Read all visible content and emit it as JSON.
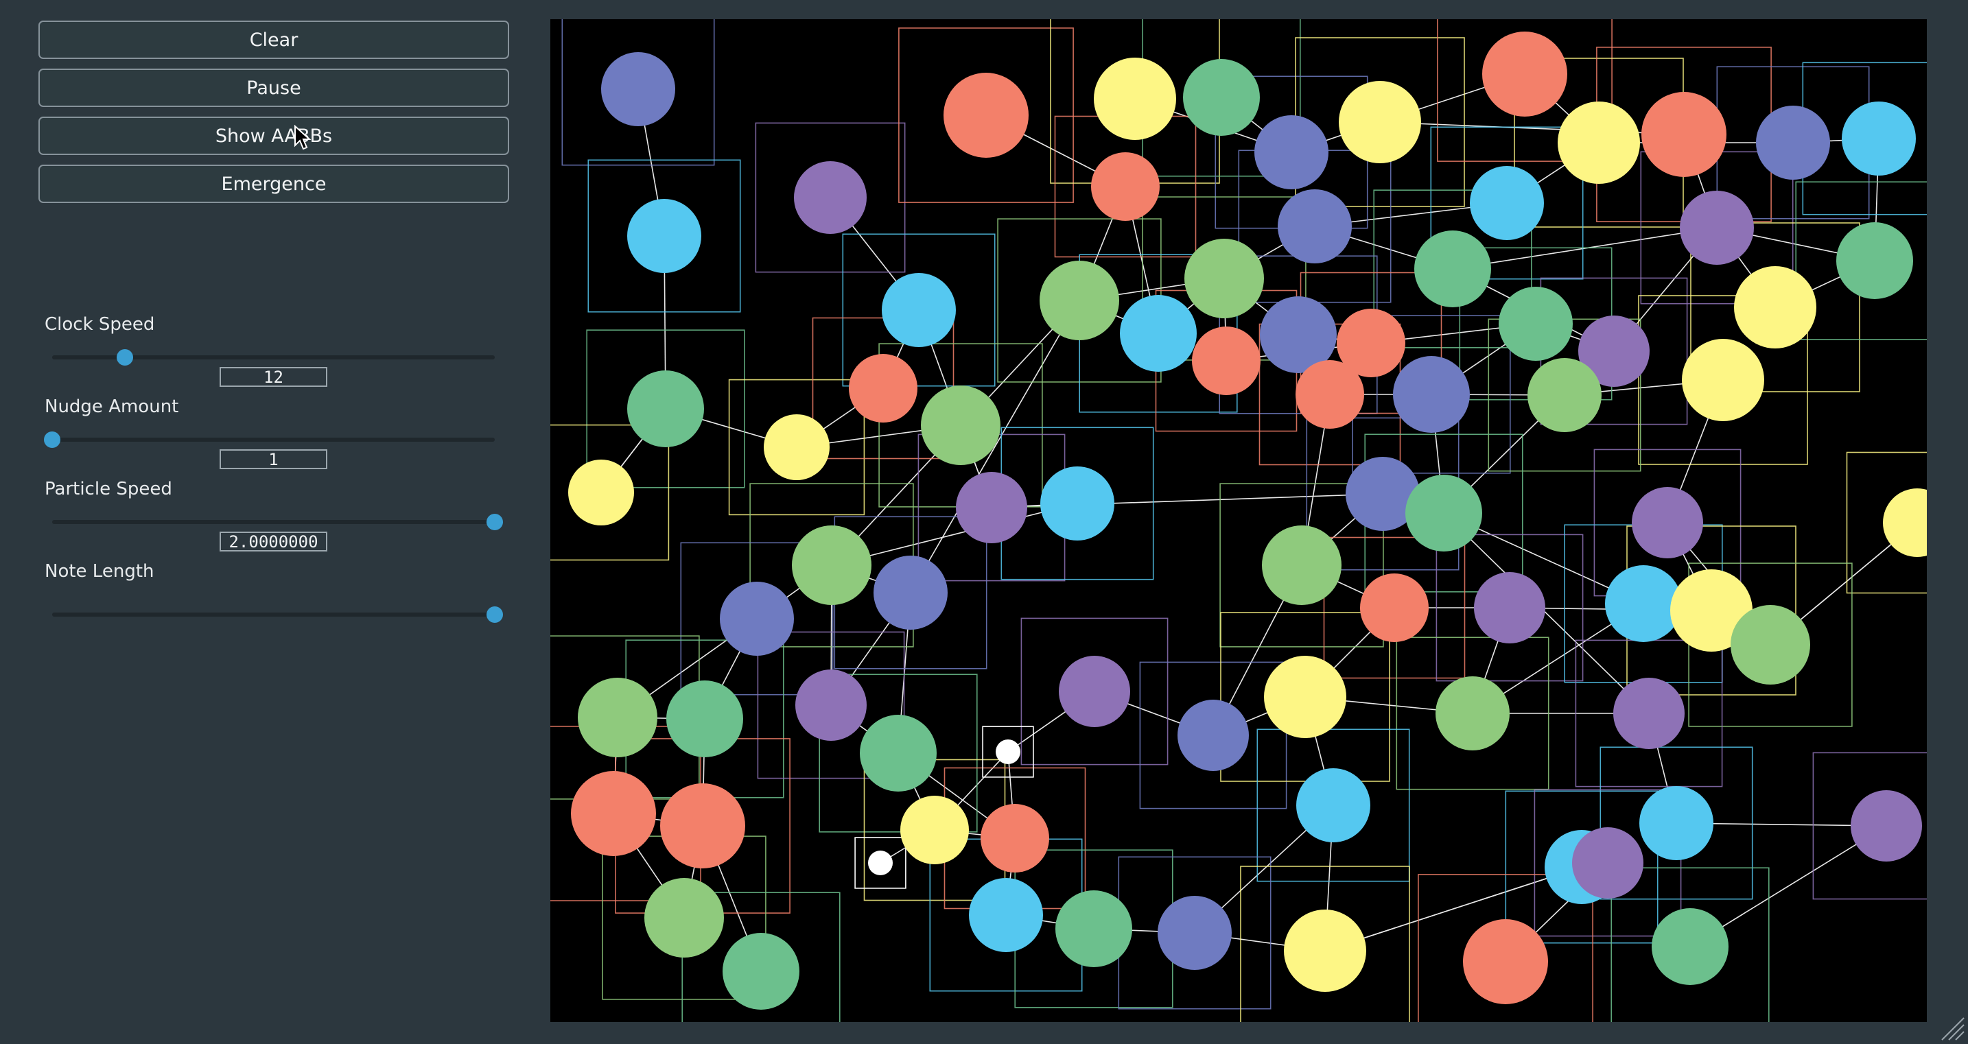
{
  "buttons": {
    "clear": "Clear",
    "pause": "Pause",
    "show_aabbs": "Show AABBs",
    "emergence": "Emergence"
  },
  "sliders": [
    {
      "id": "clock-speed",
      "label": "Clock Speed",
      "value": "12",
      "fraction": 0.165
    },
    {
      "id": "nudge-amount",
      "label": "Nudge Amount",
      "value": "1",
      "fraction": 0.0
    },
    {
      "id": "particle-speed",
      "label": "Particle Speed",
      "value": "2.0000000",
      "fraction": 1.0
    },
    {
      "id": "note-length",
      "label": "Note Length",
      "value": null,
      "fraction": 1.0
    }
  ],
  "colors": {
    "background": "#2c373e",
    "canvas": "#000000",
    "slider_thumb": "#3b9fd3",
    "particles": {
      "indigo": "#6f7bc1",
      "sky": "#55c8f0",
      "salmon": "#f3806a",
      "yellow": "#fdf685",
      "green": "#6cc08d",
      "lime": "#8fca7d",
      "purple": "#8e72b6",
      "white": "#ffffff"
    }
  },
  "icons": {
    "cursor": "arrow-cursor-icon",
    "grip": "resize-grip-icon"
  }
}
